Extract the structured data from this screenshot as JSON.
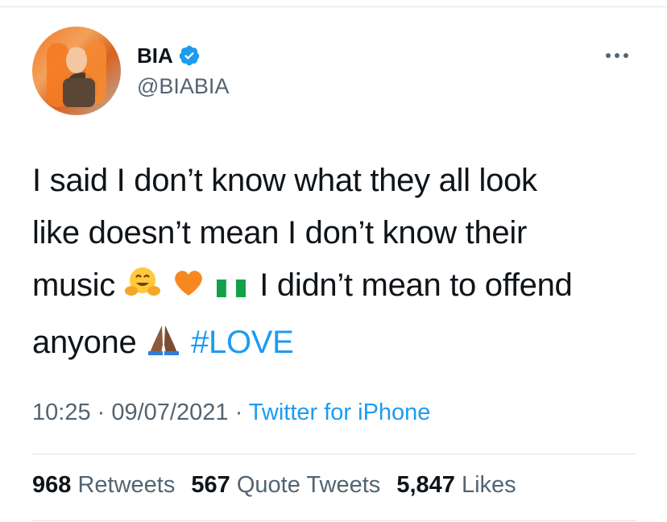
{
  "user": {
    "name": "BIA",
    "handle": "@BIABIA"
  },
  "tweet": {
    "line1": "I said I don’t know what they all look",
    "line2": "like doesn’t mean I don’t know their",
    "line3_a": "music",
    "line3_b": "I didn’t mean to offend",
    "line4_a": "anyone",
    "hashtag": "#LOVE",
    "emojis": [
      "hugging-face-icon",
      "orange-heart-icon",
      "nigeria-flag-icon",
      "folded-hands-icon"
    ]
  },
  "meta": {
    "time": "10:25",
    "sep1": " · ",
    "date": "09/07/2021",
    "sep2": " · ",
    "source": "Twitter for iPhone"
  },
  "stats": {
    "retweets_count": "968",
    "retweets_label": "Retweets",
    "quotes_count": "567",
    "quotes_label": "Quote Tweets",
    "likes_count": "5,847",
    "likes_label": "Likes"
  },
  "colors": {
    "link": "#1d9bf0",
    "secondary": "#536471",
    "primary": "#0f1419",
    "divider": "#dfe3e6"
  }
}
